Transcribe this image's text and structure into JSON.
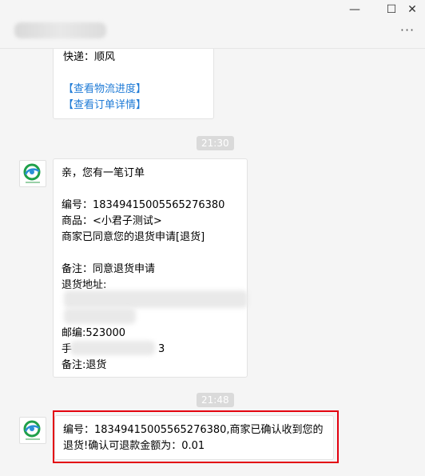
{
  "window": {
    "minimize_label": "—",
    "maximize_label": "☐",
    "close_label": "✕",
    "more_label": "···"
  },
  "messages": {
    "first": {
      "courier": "快递：顺风",
      "link_logistics": "【查看物流进度】",
      "link_order": "【查看订单详情】"
    },
    "time1": "21:30",
    "second": {
      "greeting": "亲，您有一笔订单",
      "order_no": "编号：18349415005565276380",
      "product": "商品：<小君子测试>",
      "status": "商家已同意您的退货申请[退货]",
      "remark": "备注：同意退货申请",
      "return_address_label": "退货地址:",
      "postcode": "邮编:523000",
      "phone_prefix": "手",
      "phone_suffix": "3",
      "note": "备注:退货"
    },
    "time2": "21:48",
    "third": {
      "line1": "编号：18349415005565276380,商家已确认收到您的",
      "line2": "退货!确认可退款金额为：0.01"
    }
  },
  "icons": {
    "avatar": "shop-logo-icon"
  },
  "colors": {
    "link": "#1f7bd6",
    "highlight": "#e3000f"
  }
}
